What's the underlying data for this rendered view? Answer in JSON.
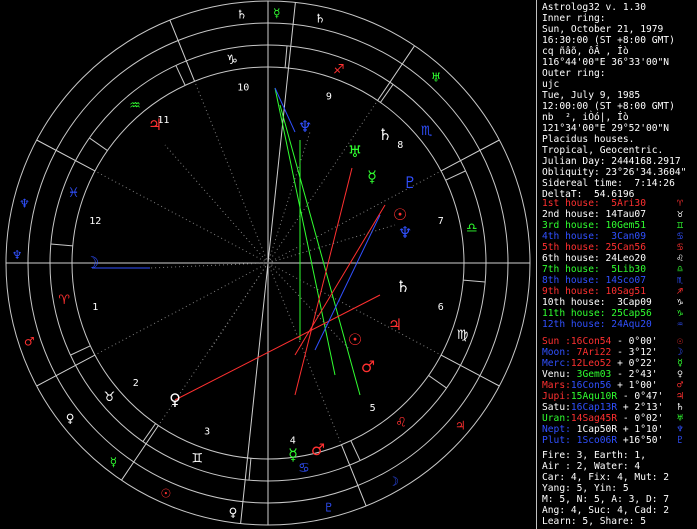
{
  "program": {
    "title": "Astrolog32 v. 1.30"
  },
  "inner_ring": {
    "heading": "Inner ring:",
    "date": "Sun, October 21, 1979",
    "time": "16:30:00 (ST +8:00 GMT)",
    "name": "cq ñâõ, ôÂ , Íò",
    "coords": "116°44'00\"E 36°33'00\"N"
  },
  "outer_ring": {
    "heading": "Outer ring:",
    "name": "ujc",
    "date": "Tue, July 9, 1985",
    "time": "12:00:00 (ST +8:00 GMT)",
    "place": "nb  ², iÒó|, Íò",
    "coords": "121°34'00\"E 29°52'00\"N"
  },
  "chart_info": {
    "houses": "Placidus houses.",
    "zodiac": "Tropical, Geocentric.",
    "julian": "Julian Day: 2444168.2917",
    "obliquity": "Obliquity: 23°26'34.3604\"",
    "sidereal": "Sidereal time:  7:14:26",
    "deltat": "DeltaT:  54.6196"
  },
  "houses": [
    {
      "text": "1st house:  5Ari30",
      "color": "#ff3030",
      "glyph": "♈"
    },
    {
      "text": "2nd house: 14Tau07",
      "color": "#ffffff",
      "glyph": "♉"
    },
    {
      "text": "3rd house: 10Gem51",
      "color": "#30ff30",
      "glyph": "♊"
    },
    {
      "text": "4th house:  3Can09",
      "color": "#3050ff",
      "glyph": "♋"
    },
    {
      "text": "5th house: 25Can56",
      "color": "#ff3030",
      "glyph": "♋"
    },
    {
      "text": "6th house: 24Leo20",
      "color": "#ffffff",
      "glyph": "♌"
    },
    {
      "text": "7th house:  5Lib30",
      "color": "#30ff30",
      "glyph": "♎"
    },
    {
      "text": "8th house: 14Sco07",
      "color": "#3050ff",
      "glyph": "♏"
    },
    {
      "text": "9th house: 10Sag51",
      "color": "#ff3030",
      "glyph": "♐"
    },
    {
      "text": "10th house:  3Cap09",
      "color": "#ffffff",
      "glyph": "♑"
    },
    {
      "text": "11th house: 25Cap56",
      "color": "#30ff30",
      "glyph": "♑"
    },
    {
      "text": "12th house: 24Aqu20",
      "color": "#3050ff",
      "glyph": "♒"
    }
  ],
  "planets": [
    {
      "label": "Sun :",
      "value": "16Con54",
      "rest": " - 0°00'",
      "lc": "#ff3030",
      "vc": "#ff3030",
      "glyph": "☉",
      "gc": "#ff3030"
    },
    {
      "label": "Moon:",
      "value": " 7Ari22",
      "rest": " - 3°12'",
      "lc": "#3050ff",
      "vc": "#ff3030",
      "glyph": "☽",
      "gc": "#3050ff"
    },
    {
      "label": "Merc:",
      "value": "12Leo52",
      "rest": " + 0°22'",
      "lc": "#3050ff",
      "vc": "#ff3030",
      "glyph": "☿",
      "gc": "#30ff30"
    },
    {
      "label": "Venu:",
      "value": " 3Gem03",
      "rest": " - 2°43'",
      "lc": "#ffffff",
      "vc": "#30ff30",
      "glyph": "♀",
      "gc": "#ffffff"
    },
    {
      "label": "Mars:",
      "value": "16Con56",
      "rest": " + 1°00'",
      "lc": "#ff3030",
      "vc": "#3050ff",
      "glyph": "♂",
      "gc": "#ff3030"
    },
    {
      "label": "Jupi:",
      "value": "15Aqu10R",
      "rest": " - 0°47'",
      "lc": "#ff3030",
      "vc": "#30ff30",
      "glyph": "♃",
      "gc": "#ff3030"
    },
    {
      "label": "Satu:",
      "value": "16Cap13R",
      "rest": " + 2°13'",
      "lc": "#ffffff",
      "vc": "#3050ff",
      "glyph": "♄",
      "gc": "#ffffff"
    },
    {
      "label": "Uran:",
      "value": "14Sag45R",
      "rest": " - 0°02'",
      "lc": "#30ff30",
      "vc": "#ff3030",
      "glyph": "♅",
      "gc": "#30ff30"
    },
    {
      "label": "Nept:",
      "value": " 1Cap50R",
      "rest": " + 1°10'",
      "lc": "#3050ff",
      "vc": "#ffffff",
      "glyph": "♆",
      "gc": "#3050ff"
    },
    {
      "label": "Plut:",
      "value": " 1Sco06R",
      "rest": " +16°50'",
      "lc": "#3050ff",
      "vc": "#3050ff",
      "glyph": "♇",
      "gc": "#3050ff"
    }
  ],
  "summary": [
    "Fire: 3, Earth: 1,",
    "Air : 2, Water: 4",
    "Car: 4, Fix: 4, Mut: 2",
    "Yang: 5, Yin: 5",
    "M: 5, N: 5, A: 3, D: 7",
    "Ang: 4, Suc: 4, Cad: 2",
    "Learn: 5, Share: 5"
  ],
  "wheel": {
    "house_numbers": [
      "1",
      "2",
      "3",
      "4",
      "5",
      "6",
      "7",
      "8",
      "9",
      "10",
      "11",
      "12"
    ],
    "sign_glyphs": [
      {
        "glyph": "♈",
        "color": "#ff3030"
      },
      {
        "glyph": "♉",
        "color": "#ffffff"
      },
      {
        "glyph": "♊",
        "color": "#ffffff"
      },
      {
        "glyph": "♋",
        "color": "#3050ff"
      },
      {
        "glyph": "♌",
        "color": "#ff3030"
      },
      {
        "glyph": "♍",
        "color": "#ffffff"
      },
      {
        "glyph": "♎",
        "color": "#30ff30"
      },
      {
        "glyph": "♏",
        "color": "#3050ff"
      },
      {
        "glyph": "♐",
        "color": "#ff3030"
      },
      {
        "glyph": "♑",
        "color": "#ffffff"
      },
      {
        "glyph": "♒",
        "color": "#30ff30"
      },
      {
        "glyph": "♓",
        "color": "#3050ff"
      }
    ],
    "outer_ring_glyphs": [
      {
        "glyph": "♆",
        "color": "#3050ff"
      },
      {
        "glyph": "♆",
        "color": "#3050ff"
      },
      {
        "glyph": "♂",
        "color": "#ff3030"
      },
      {
        "glyph": "♀",
        "color": "#ffffff"
      },
      {
        "glyph": "☿",
        "color": "#30ff30"
      },
      {
        "glyph": "☉",
        "color": "#ff3030"
      },
      {
        "glyph": "♀",
        "color": "#ffffff"
      },
      {
        "glyph": "♇",
        "color": "#3050ff"
      },
      {
        "glyph": "☽",
        "color": "#3050ff"
      },
      {
        "glyph": "♃",
        "color": "#ff3030"
      },
      {
        "glyph": "♅",
        "color": "#30ff30"
      },
      {
        "glyph": "♄",
        "color": "#ffffff"
      },
      {
        "glyph": "☿",
        "color": "#30ff30"
      },
      {
        "glyph": "♄",
        "color": "#ffffff"
      }
    ],
    "inner_planets": [
      {
        "glyph": "☽",
        "color": "#3050ff"
      },
      {
        "glyph": "♃",
        "color": "#ff3030"
      },
      {
        "glyph": "♆",
        "color": "#3050ff"
      },
      {
        "glyph": "♅",
        "color": "#30ff30"
      },
      {
        "glyph": "♄",
        "color": "#ffffff"
      },
      {
        "glyph": "☿",
        "color": "#30ff30"
      },
      {
        "glyph": "♇",
        "color": "#3050ff"
      },
      {
        "glyph": "☉",
        "color": "#ff3030"
      },
      {
        "glyph": "♆",
        "color": "#3050ff"
      },
      {
        "glyph": "♄",
        "color": "#ffffff"
      },
      {
        "glyph": "♃",
        "color": "#ff3030"
      },
      {
        "glyph": "☉",
        "color": "#ff3030"
      },
      {
        "glyph": "♂",
        "color": "#ff3030"
      },
      {
        "glyph": "☿",
        "color": "#30ff30"
      },
      {
        "glyph": "♀",
        "color": "#ffffff"
      },
      {
        "glyph": "♂",
        "color": "#ff3030"
      }
    ]
  }
}
